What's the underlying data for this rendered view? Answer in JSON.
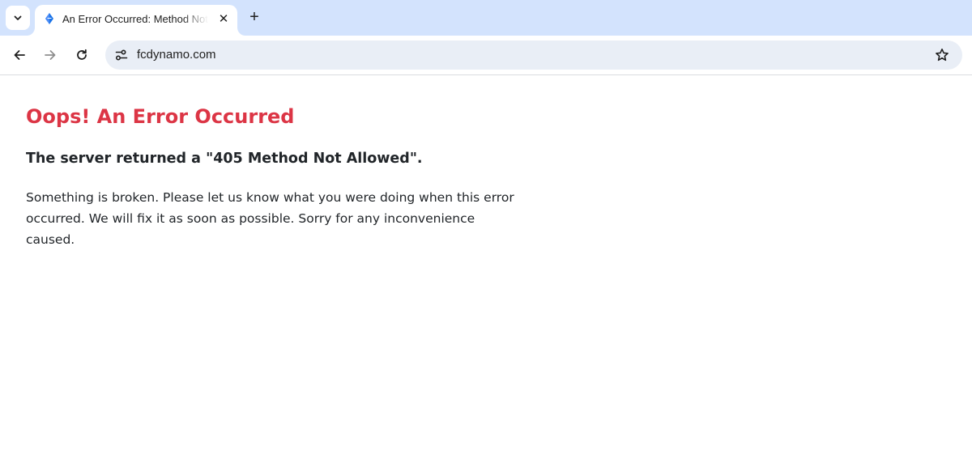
{
  "browser": {
    "tab": {
      "title": "An Error Occurred: Method Not Allowed",
      "close_symbol": "✕"
    },
    "new_tab_symbol": "+",
    "address_bar": {
      "url": "fcdynamo.com"
    },
    "icons": {
      "tab_search": "chevron-down-icon",
      "favicon": "diamond-favicon-icon",
      "back": "arrow-left-icon",
      "forward": "arrow-right-icon",
      "reload": "reload-icon",
      "site_info": "tune-icon",
      "bookmark": "star-outline-icon"
    },
    "colors": {
      "tabstrip_bg": "#d3e3fd",
      "omnibox_bg": "#e9eef6"
    }
  },
  "page": {
    "title": "Oops! An Error Occurred",
    "subtitle": "The server returned a \"405 Method Not Allowed\".",
    "message": "Something is broken. Please let us know what you were doing when this error occurred. We will fix it as soon as possible. Sorry for any inconvenience caused.",
    "colors": {
      "title": "#dc3545",
      "text": "#212529"
    }
  }
}
